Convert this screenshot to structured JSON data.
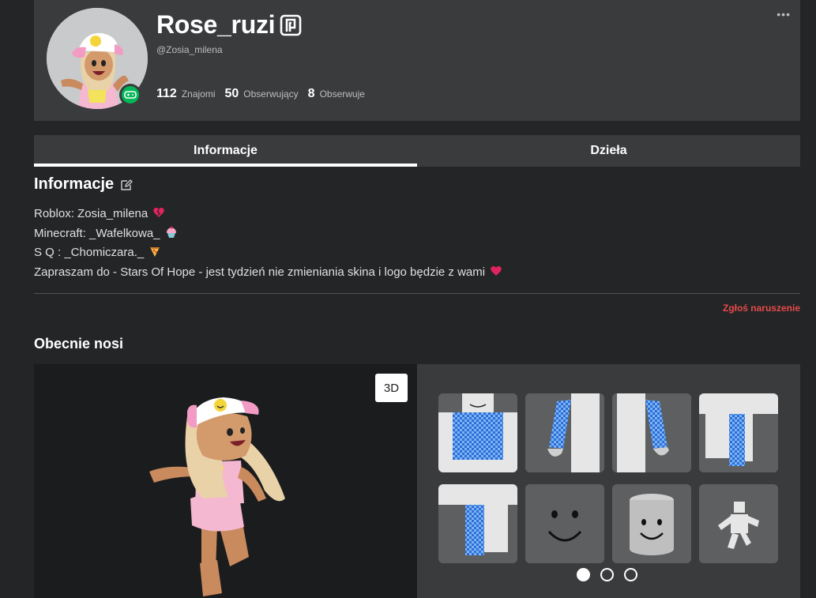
{
  "profile": {
    "display_name": "Rose_ruzi",
    "username": "@Zosia_milena",
    "stats": [
      {
        "value": "112",
        "label": "Znajomi"
      },
      {
        "value": "50",
        "label": "Obserwujący"
      },
      {
        "value": "8",
        "label": "Obserwuje"
      }
    ],
    "more_label": "•••",
    "presence_icon": "gamepad-icon",
    "badge_icon": "premium-icon"
  },
  "tabs": [
    {
      "label": "Informacje",
      "active": true
    },
    {
      "label": "Dzieła",
      "active": false
    }
  ],
  "about": {
    "title": "Informacje",
    "lines": [
      {
        "text": "Roblox: Zosia_milena",
        "emoji": "💔"
      },
      {
        "text": "Minecraft: _Wafelkowa_",
        "emoji": "🧁"
      },
      {
        "text": "S Q : _Chomiczara._",
        "emoji": "🍕"
      },
      {
        "text": "Zapraszam do - Stars Of Hope - jest tydzień nie zmieniania skina i logo będzie z wami",
        "emoji": "❤️"
      }
    ],
    "report_label": "Zgłoś naruszenie"
  },
  "wearing": {
    "title": "Obecnie nosi",
    "view_toggle_label": "3D",
    "items": [
      {
        "name": "blue-checkered-shirt"
      },
      {
        "name": "blue-sleeve-left-arm"
      },
      {
        "name": "blue-sleeve-right-arm"
      },
      {
        "name": "blue-pants-right-leg"
      },
      {
        "name": "blue-pants-left-leg"
      },
      {
        "name": "smile-face"
      },
      {
        "name": "smile-head"
      },
      {
        "name": "animation-pack"
      }
    ],
    "pages": 3,
    "current_page": 1
  },
  "colors": {
    "background": "#232527",
    "card": "#393b3d",
    "accent_green": "#02b757",
    "report_red": "#e84a4a"
  }
}
